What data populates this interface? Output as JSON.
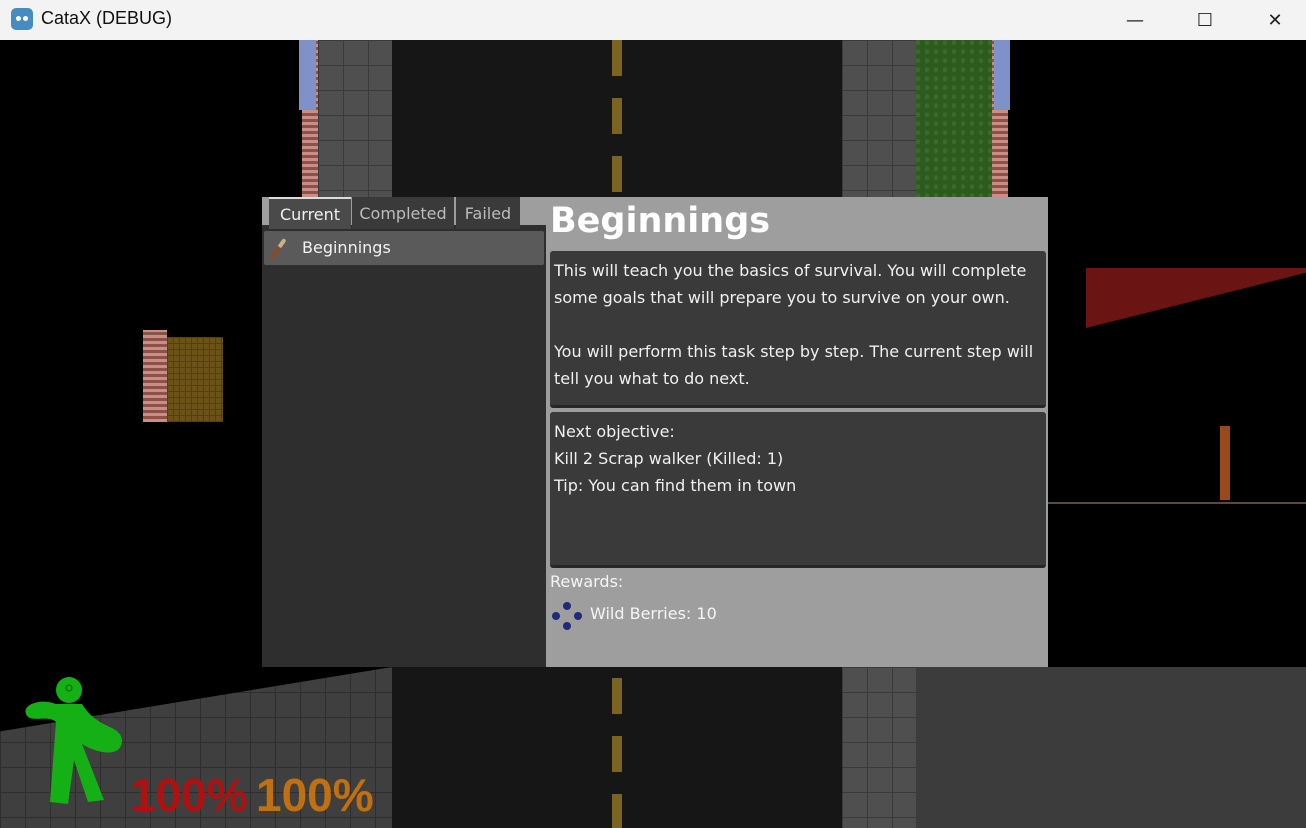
{
  "window": {
    "title": "CataX (DEBUG)",
    "minimize": "—",
    "maximize": "☐",
    "close": "✕"
  },
  "quest_panel": {
    "tabs": [
      "Current",
      "Completed",
      "Failed"
    ],
    "quests": [
      "Beginnings"
    ],
    "title": "Beginnings",
    "description": [
      "This will teach you the basics of survival. You will complete",
      "some goals that will prepare you to survive on your own.",
      "",
      "You will perform this task step by step. The current step will",
      "tell you what to do next."
    ],
    "objective": [
      "Next objective:",
      "Kill 2 Scrap walker (Killed: 1)",
      "Tip: You can find them in town"
    ],
    "rewards_title": "Rewards:",
    "reward_item": "Wild Berries: 10"
  },
  "hud": {
    "health": "100%",
    "stamina": "100%",
    "health_color": "#b01010",
    "stamina_color": "#c07010",
    "body_color": "#15b015"
  }
}
